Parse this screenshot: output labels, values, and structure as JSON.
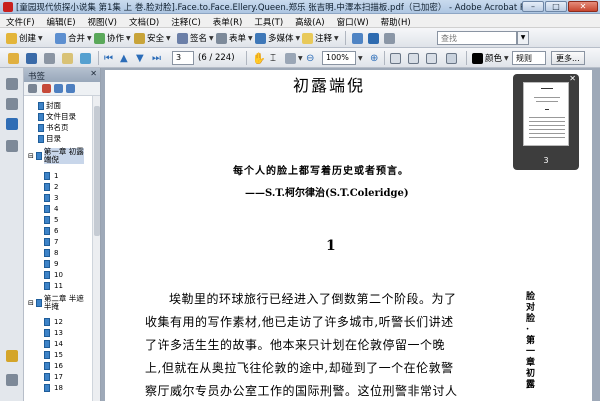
{
  "window": {
    "title": "[童园现代侦探小说集 第1集 上 巻.脸对脸].Face.to.Face.Ellery.Queen.郑乐 张吉明.中澤本扫描板.pdf（已加密） - Adobe Acrobat Pro",
    "min": "–",
    "max": "□",
    "close": "✕"
  },
  "menu": [
    "文件(F)",
    "编辑(E)",
    "视图(V)",
    "文档(D)",
    "注释(C)",
    "表单(R)",
    "工具(T)",
    "高级(A)",
    "窗口(W)",
    "帮助(H)"
  ],
  "toolbar1": {
    "create": "创建",
    "merge": "合并",
    "collaborate": "协作",
    "secure": "安全",
    "sign": "签名",
    "forms": "表单",
    "multimedia": "多媒体",
    "comment": "注释",
    "search_placeholder": "查找"
  },
  "toolbar2": {
    "page_current": "3",
    "page_count": "(6 / 224)",
    "zoom": "100%",
    "color_label": "颜色",
    "rules_label": "规则",
    "more_label": "更多..."
  },
  "bookmarks": {
    "header": "书签",
    "close": "✕",
    "items": [
      "封面",
      "文件目录",
      "书名页",
      "目录"
    ],
    "chapter1": "第一章 初露端倪",
    "chapter1_pages": [
      "1",
      "2",
      "3",
      "4",
      "5",
      "6",
      "7",
      "8",
      "9",
      "10",
      "11"
    ],
    "chapter2": "第二章 半遮半掩",
    "chapter2_pages": [
      "12",
      "13",
      "14",
      "15",
      "16",
      "17",
      "18",
      "19",
      "20",
      "21",
      "22"
    ]
  },
  "document": {
    "chapter_title": "初露端倪",
    "epigraph": "每个人的脸上都写着历史或者预言。",
    "attribution": "——S.T.柯尔律治(S.T.Coleridge)",
    "section_number": "1",
    "paragraph_lines": [
      "埃勒里的环球旅行已经进入了倒数第二个阶段。为了",
      "收集有用的写作素材,他已走访了许多城市,听警长们讲述",
      "了许多活生生的故事。他本来只计划在伦敦停留一个晚",
      "上,但就在从奥拉飞往伦敦的途中,却碰到了一个在伦敦警",
      "察厅威尔专员办公室工作的国际刑警。这位刑警非常讨人"
    ],
    "side_running_head": "脸对脸·第一章　初露"
  },
  "thumbnail": {
    "page_number": "3",
    "close": "✕"
  }
}
